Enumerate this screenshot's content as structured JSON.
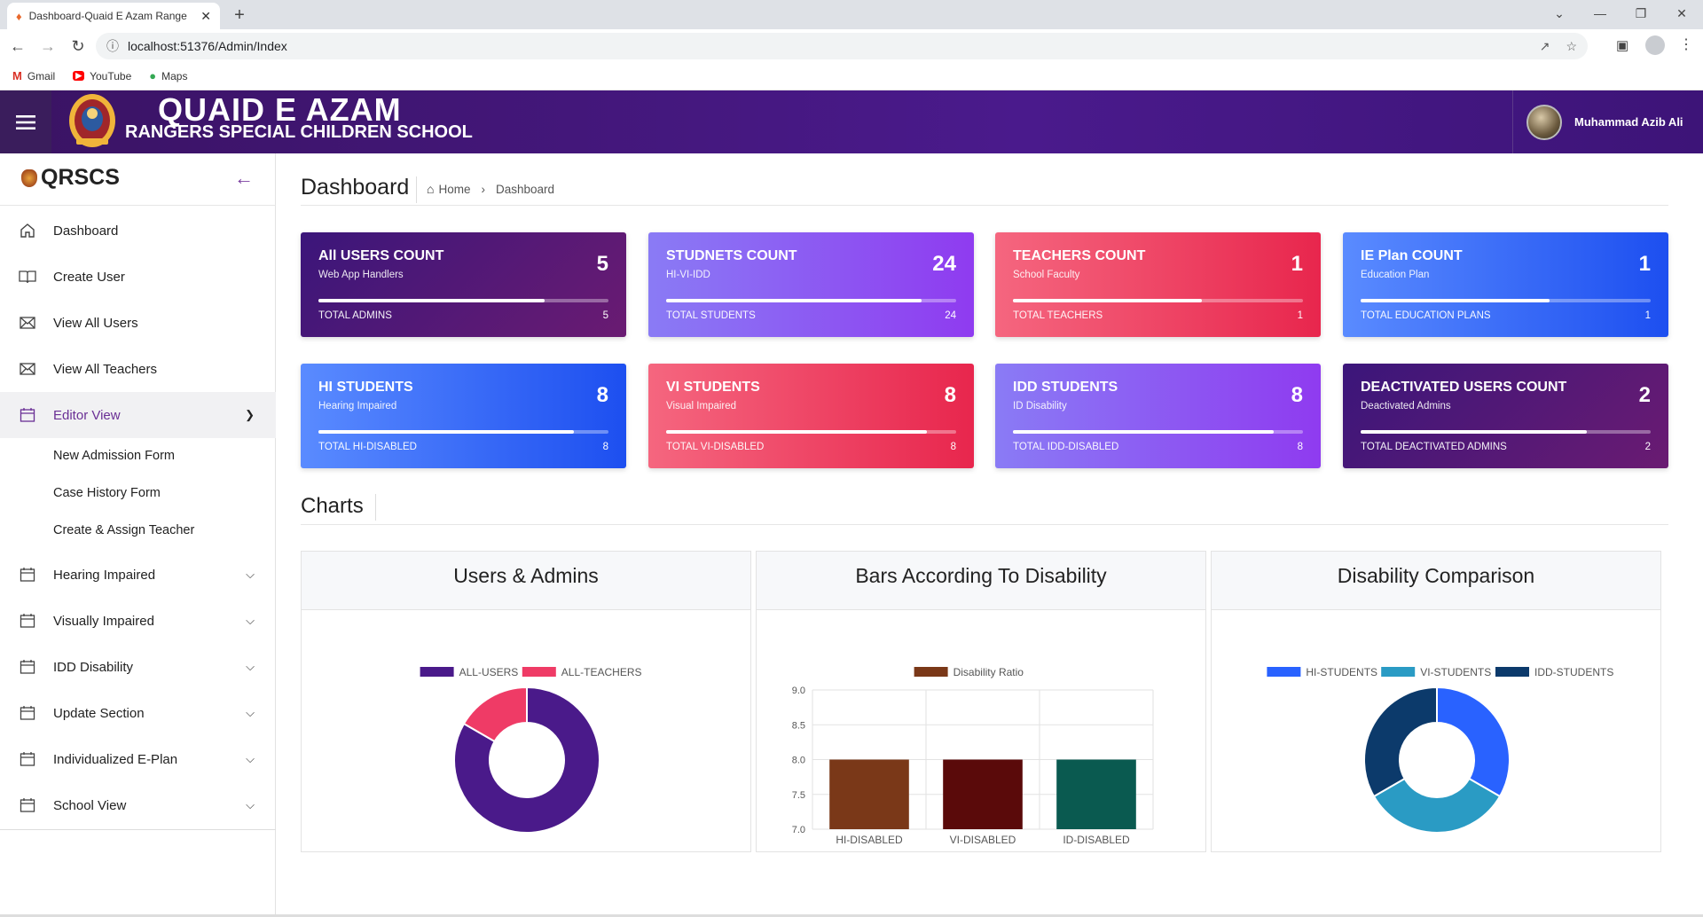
{
  "browser": {
    "tab_title": "Dashboard-Quaid E Azam Range",
    "url": "localhost:51376/Admin/Index",
    "bookmarks": [
      {
        "label": "Gmail",
        "icon": "gmail-icon",
        "color": "#d93025"
      },
      {
        "label": "YouTube",
        "icon": "youtube-icon",
        "color": "#ff0000"
      },
      {
        "label": "Maps",
        "icon": "maps-icon",
        "color": "#34a853"
      }
    ]
  },
  "header": {
    "title_line1": "QUAID E AZAM",
    "title_line2": "RANGERS SPECIAL CHILDREN SCHOOL",
    "user_name": "Muhammad Azib Ali"
  },
  "sidebar": {
    "brand": "QRSCS",
    "items": [
      {
        "label": "Dashboard",
        "icon": "home-icon"
      },
      {
        "label": "Create User",
        "icon": "book-icon"
      },
      {
        "label": "View All Users",
        "icon": "envelope-icon"
      },
      {
        "label": "View All Teachers",
        "icon": "envelope-icon"
      },
      {
        "label": "Editor View",
        "icon": "calendar-icon",
        "expanded": true
      },
      {
        "label": "Hearing Impaired",
        "icon": "calendar-icon"
      },
      {
        "label": "Visually Impaired",
        "icon": "calendar-icon"
      },
      {
        "label": "IDD Disability",
        "icon": "calendar-icon"
      },
      {
        "label": "Update Section",
        "icon": "calendar-icon"
      },
      {
        "label": "Individualized E-Plan",
        "icon": "calendar-icon"
      },
      {
        "label": "School View",
        "icon": "calendar-icon"
      }
    ],
    "editor_sub": [
      "New Admission Form",
      "Case History Form",
      "Create & Assign Teacher"
    ]
  },
  "page": {
    "title": "Dashboard",
    "breadcrumb_home": "Home",
    "breadcrumb_current": "Dashboard",
    "charts_title": "Charts"
  },
  "cards": [
    {
      "title": "All USERS COUNT",
      "subtitle": "Web App Handlers",
      "value": "5",
      "footer_label": "TOTAL ADMINS",
      "footer_value": "5",
      "progress": 0.78
    },
    {
      "title": "STUDNETS COUNT",
      "subtitle": "HI-VI-IDD",
      "value": "24",
      "footer_label": "TOTAL STUDENTS",
      "footer_value": "24",
      "progress": 0.88
    },
    {
      "title": "TEACHERS COUNT",
      "subtitle": "School Faculty",
      "value": "1",
      "footer_label": "TOTAL TEACHERS",
      "footer_value": "1",
      "progress": 0.65
    },
    {
      "title": "IE Plan COUNT",
      "subtitle": "Education Plan",
      "value": "1",
      "footer_label": "TOTAL EDUCATION PLANS",
      "footer_value": "1",
      "progress": 0.65
    },
    {
      "title": "HI STUDENTS",
      "subtitle": "Hearing Impaired",
      "value": "8",
      "footer_label": "TOTAL HI-DISABLED",
      "footer_value": "8",
      "progress": 0.88
    },
    {
      "title": "VI STUDENTS",
      "subtitle": "Visual Impaired",
      "value": "8",
      "footer_label": "TOTAL VI-DISABLED",
      "footer_value": "8",
      "progress": 0.9
    },
    {
      "title": "IDD STUDENTS",
      "subtitle": "ID Disability",
      "value": "8",
      "footer_label": "TOTAL IDD-DISABLED",
      "footer_value": "8",
      "progress": 0.9
    },
    {
      "title": "DEACTIVATED USERS COUNT",
      "subtitle": "Deactivated Admins",
      "value": "2",
      "footer_label": "TOTAL DEACTIVATED ADMINS",
      "footer_value": "2",
      "progress": 0.78
    }
  ],
  "chart_data": [
    {
      "type": "pie",
      "title": "Users & Admins",
      "labels": [
        "ALL-USERS",
        "ALL-TEACHERS"
      ],
      "values": [
        5,
        1
      ],
      "colors": [
        "#4a1a8a",
        "#ef3b66"
      ],
      "legend": "top"
    },
    {
      "type": "bar",
      "title": "Bars According To Disability",
      "categories": [
        "HI-DISABLED",
        "VI-DISABLED",
        "ID-DISABLED"
      ],
      "series": [
        {
          "name": "Disability Ratio",
          "values": [
            8,
            8,
            8
          ]
        }
      ],
      "colors": [
        "#7a3818",
        "#5a0a0a",
        "#0a5a50"
      ],
      "ylim": [
        7.0,
        9.0
      ],
      "yticks": [
        "9.0",
        "8.5",
        "8.0",
        "7.5",
        "7.0"
      ],
      "legend": "top"
    },
    {
      "type": "pie",
      "title": "Disability Comparison",
      "labels": [
        "HI-STUDENTS",
        "VI-STUDENTS",
        "IDD-STUDENTS"
      ],
      "values": [
        8,
        8,
        8
      ],
      "colors": [
        "#2962ff",
        "#2a9bc4",
        "#0c3a6b"
      ],
      "legend": "top"
    }
  ]
}
